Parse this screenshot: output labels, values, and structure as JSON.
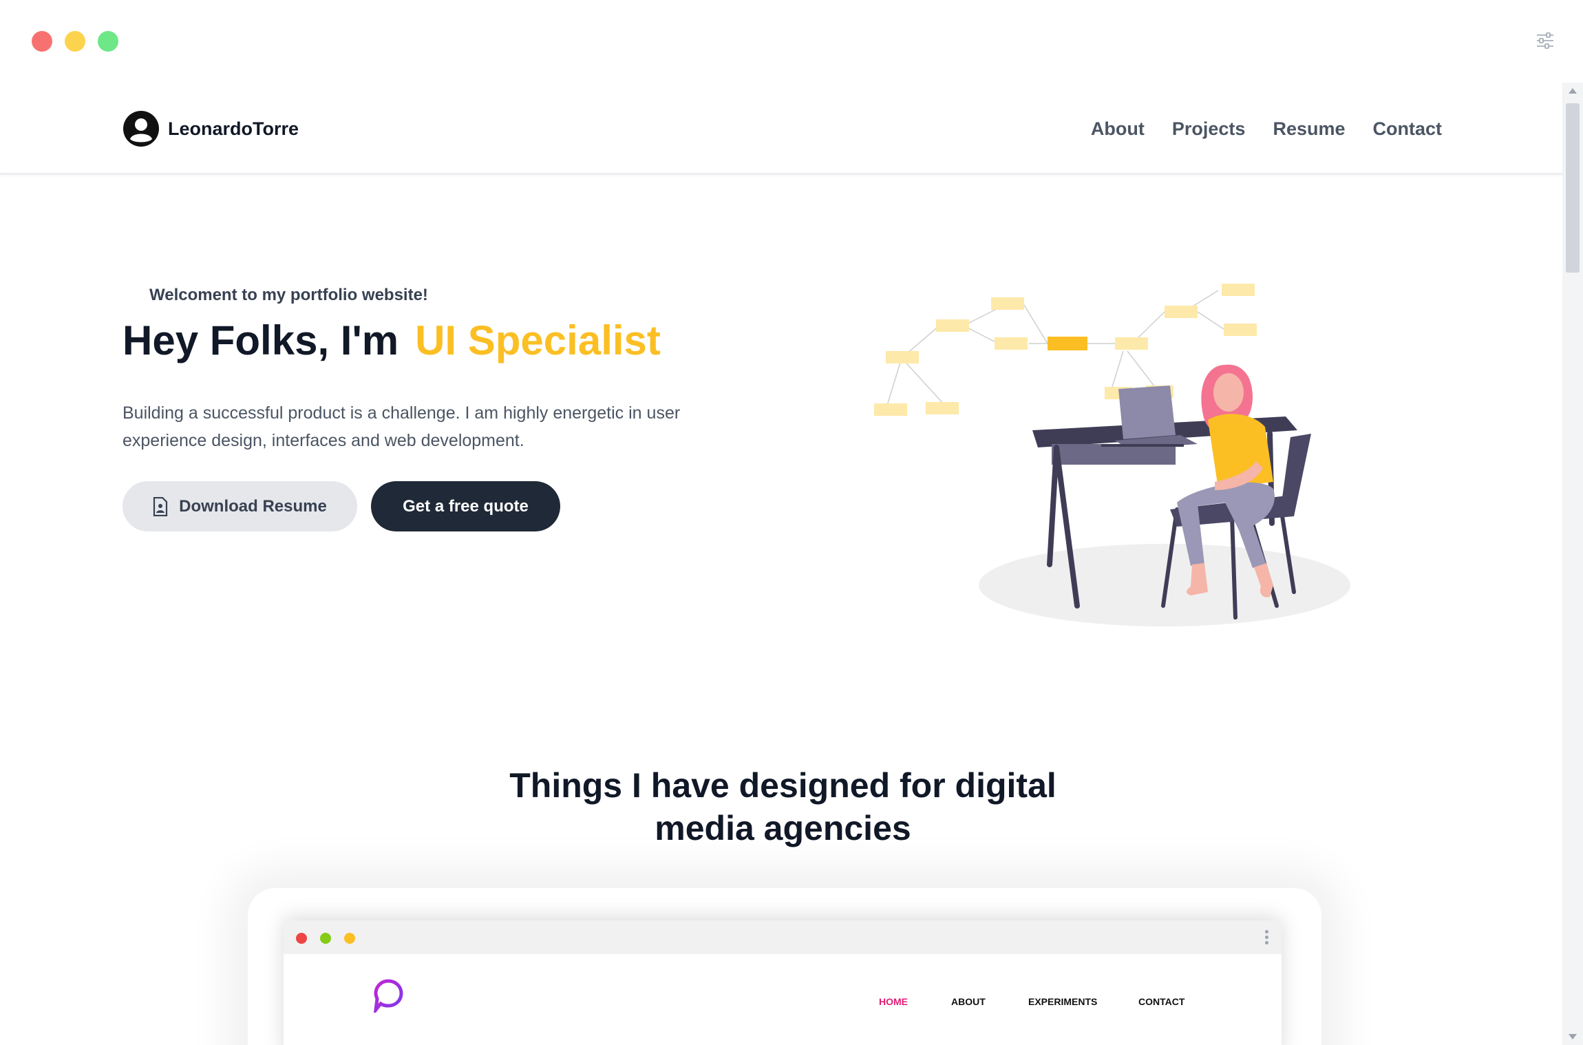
{
  "window": {
    "controls": [
      "close",
      "minimize",
      "maximize"
    ],
    "settings_icon": "sliders-icon"
  },
  "header": {
    "brand_name": "LeonardoTorre",
    "nav": [
      {
        "label": "About"
      },
      {
        "label": "Projects"
      },
      {
        "label": "Resume"
      },
      {
        "label": "Contact"
      }
    ]
  },
  "hero": {
    "eyebrow": "Welcoment to my portfolio website!",
    "title_prefix": "Hey Folks, I'm",
    "title_accent": "UI Specialist",
    "description": "Building a successful product is a challenge. I am highly energetic in user experience design, interfaces and web development.",
    "primary_button": "Download Resume",
    "secondary_button": "Get a free quote"
  },
  "section": {
    "title": "Things I have designed for digital media agencies"
  },
  "project_preview": {
    "nav": {
      "home": "HOME",
      "about": "ABOUT",
      "experiments": "EXPERIMENTS",
      "contact": "CONTACT"
    }
  },
  "colors": {
    "accent": "#fbbf24",
    "dark_button": "#1f2937",
    "light_button": "#e5e7eb",
    "preview_active": "#e11d74"
  }
}
